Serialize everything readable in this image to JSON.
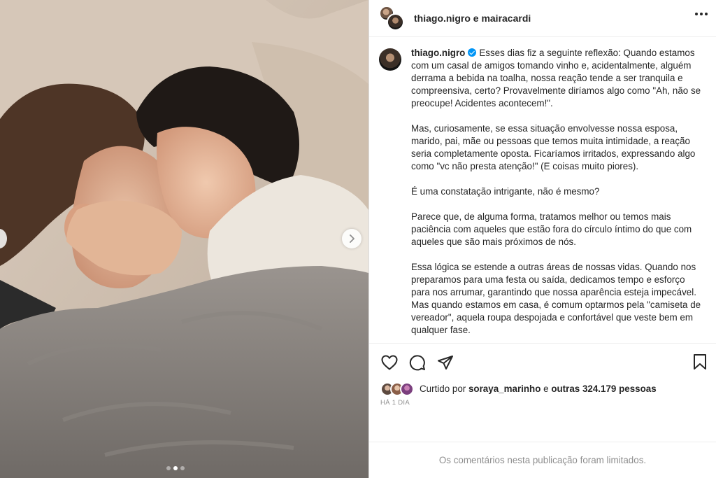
{
  "header": {
    "title": "thiago.nigro e mairacardi",
    "more_icon": "more-horizontal-icon"
  },
  "media": {
    "carousel_next_icon": "chevron-right-icon",
    "slide_count": 3,
    "active_slide": 2
  },
  "caption": {
    "username": "thiago.nigro",
    "verified_icon": "verified-badge-icon",
    "paragraphs": [
      "Esses dias fiz a seguinte reflexão: Quando estamos com um casal de amigos tomando vinho e, acidentalmente, alguém derrama a bebida na toalha, nossa reação tende a ser tranquila e compreensiva, certo? Provavelmente diríamos algo como \"Ah, não se preocupe! Acidentes acontecem!\".",
      "Mas, curiosamente, se essa situação envolvesse nossa esposa, marido, pai, mãe ou pessoas que temos muita intimidade, a reação seria completamente oposta. Ficaríamos irritados, expressando algo como \"vc não presta atenção!\" (E coisas muito piores).",
      "É uma constatação intrigante, não é mesmo?",
      "Parece que, de alguma forma, tratamos melhor ou temos mais paciência com aqueles que estão fora do círculo íntimo do que com aqueles que são mais próximos de nós.",
      "Essa lógica se estende a outras áreas de nossas vidas. Quando nos preparamos para uma festa ou saída, dedicamos tempo e esforço para nos arrumar, garantindo que nossa aparência esteja impecável. Mas quando estamos em casa, é comum optarmos pela \"camiseta de vereador\", aquela roupa despojada e confortável que veste bem em qualquer fase."
    ]
  },
  "actions": {
    "like_icon": "heart-icon",
    "comment_icon": "comment-bubble-icon",
    "share_icon": "paper-plane-icon",
    "save_icon": "bookmark-icon"
  },
  "likes": {
    "prefix": "Curtido por ",
    "first_user": "soraya_marinho",
    "middle": " e ",
    "others": "outras 324.179 pessoas"
  },
  "time_ago": "HÁ 1 DIA",
  "comments_notice": "Os comentários nesta publicação foram limitados."
}
